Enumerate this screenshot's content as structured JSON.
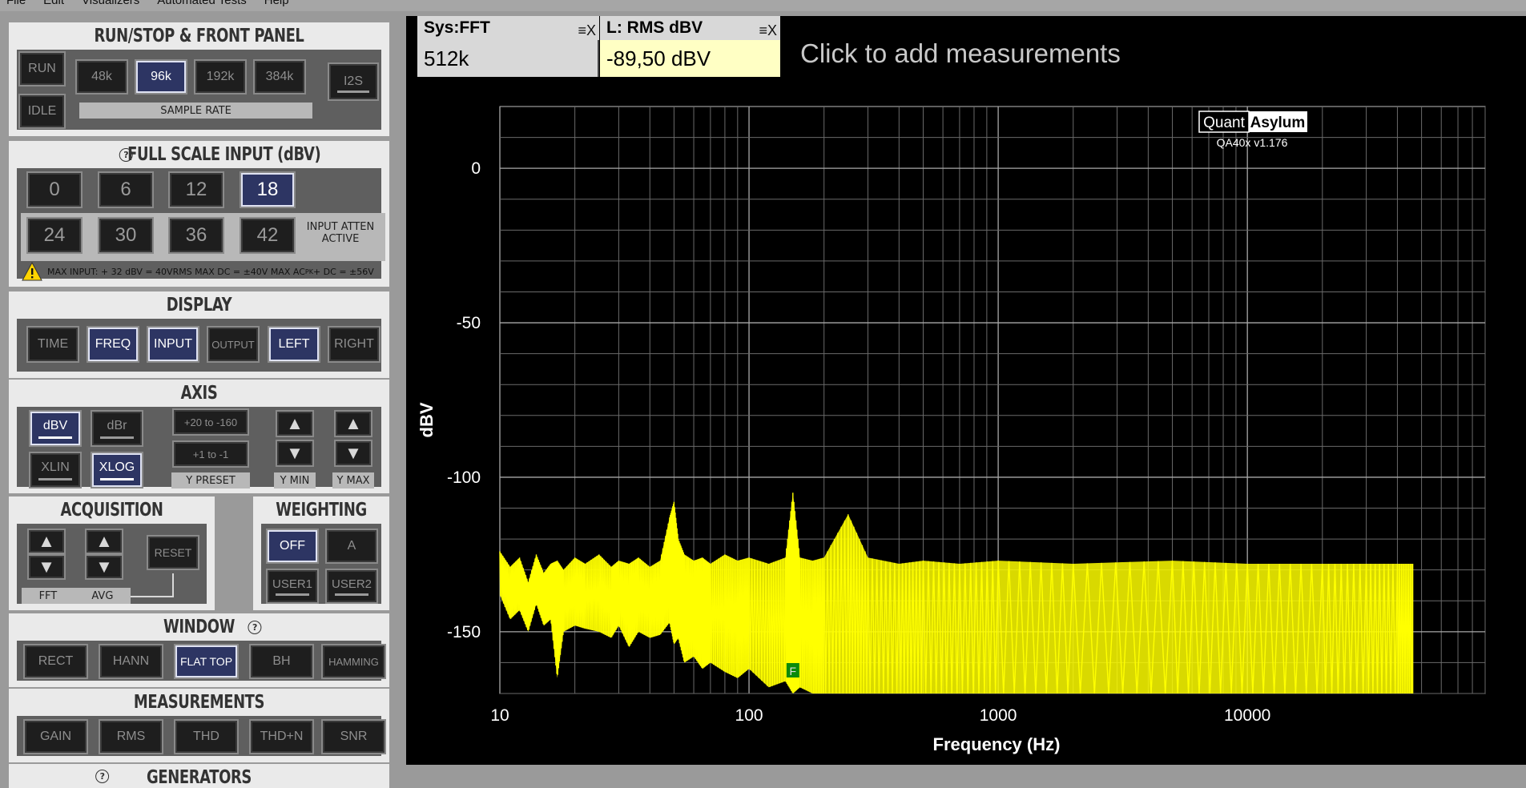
{
  "menu": [
    "File",
    "Edit",
    "Visualizers",
    "Automated Tests",
    "Help"
  ],
  "panels": {
    "run": {
      "title": "RUN/STOP & FRONT PANEL",
      "run": "RUN",
      "idle": "IDLE",
      "rates": [
        "48k",
        "96k",
        "192k",
        "384k"
      ],
      "rate_selected": "96k",
      "rate_label": "SAMPLE RATE",
      "i2s": "I2S"
    },
    "fsi": {
      "title": "FULL SCALE INPUT (dBV)",
      "values": [
        "0",
        "6",
        "12",
        "18",
        "24",
        "30",
        "36",
        "42"
      ],
      "selected": "18",
      "atten_label_1": "INPUT ATTEN",
      "atten_label_2": "ACTIVE",
      "warning": "MAX INPUT: + 32 dBV = 40VRMS    MAX DC = ±40V    MAX AC",
      "warning_sub": "PK",
      "warning_tail": " + DC = ±56V"
    },
    "display": {
      "title": "DISPLAY",
      "buttons": [
        "TIME",
        "FREQ",
        "INPUT",
        "OUTPUT",
        "LEFT",
        "RIGHT"
      ]
    },
    "axis": {
      "title": "AXIS",
      "dbv": "dBV",
      "dbr": "dBr",
      "xlin": "XLIN",
      "xlog": "XLOG",
      "preset1": "+20 to -160",
      "preset2": "+1 to -1",
      "ypreset": "Y PRESET",
      "ymin": "Y MIN",
      "ymax": "Y MAX"
    },
    "acq": {
      "title": "ACQUISITION",
      "reset": "RESET",
      "fft": "FFT",
      "avg": "AVG"
    },
    "weighting": {
      "title": "WEIGHTING",
      "off": "OFF",
      "a": "A",
      "user1": "USER1",
      "user2": "USER2"
    },
    "window": {
      "title": "WINDOW",
      "buttons": [
        "RECT",
        "HANN",
        "FLAT TOP",
        "BH",
        "HAMMING"
      ],
      "selected": "FLAT TOP"
    },
    "measurements": {
      "title": "MEASUREMENTS",
      "buttons": [
        "GAIN",
        "RMS",
        "THD",
        "THD+N",
        "SNR"
      ]
    },
    "generators": {
      "title": "GENERATORS"
    }
  },
  "meas_boxes": [
    {
      "title": "Sys:FFT",
      "value": "512k",
      "bg": "#d8d8d8"
    },
    {
      "title": "L: RMS dBV",
      "value": "-89,50 dBV",
      "bg": "#ffffc4"
    }
  ],
  "meas_ctrl": "≡X",
  "click_add": "Click to add measurements",
  "logo": {
    "left": "Quant",
    "right": "Asylum",
    "version": "QA40x v1.176"
  },
  "marker": "F",
  "colors": {
    "trace": "#ffff00",
    "plot_bg": "#000000",
    "button_on": "#2d3563"
  },
  "chart_data": {
    "type": "line",
    "xlabel": "Frequency (Hz)",
    "ylabel": "dBV",
    "xscale": "log",
    "xlim": [
      10,
      90000
    ],
    "ylim": [
      -170,
      20
    ],
    "xticks": [
      10,
      100,
      1000,
      10000
    ],
    "xtick_labels": [
      "10",
      "100",
      "1000",
      "10000"
    ],
    "yticks": [
      0,
      -50,
      -100,
      -150
    ],
    "ytick_labels": [
      "0",
      "-50",
      "-100",
      "-150"
    ],
    "grid": true,
    "series": [
      {
        "x": [
          10,
          11,
          12,
          13,
          14,
          15,
          16,
          17,
          18,
          20,
          22,
          25,
          28,
          30,
          33,
          36,
          40,
          44,
          48,
          50,
          52,
          55,
          60,
          65,
          70,
          80,
          90,
          100,
          120,
          140,
          150,
          160,
          180,
          200,
          250,
          300,
          400,
          500,
          700,
          1000,
          2000,
          5000,
          10000,
          20000,
          30000,
          40000,
          46000
        ],
        "y_top": [
          -124,
          -129,
          -126,
          -134,
          -125,
          -131,
          -128,
          -127,
          -130,
          -126,
          -128,
          -125,
          -129,
          -127,
          -128,
          -126,
          -129,
          -127,
          -113,
          -108,
          -120,
          -125,
          -127,
          -126,
          -128,
          -125,
          -127,
          -126,
          -128,
          -126,
          -105,
          -126,
          -127,
          -126,
          -112,
          -126,
          -128,
          -127,
          -128,
          -127,
          -128,
          -127,
          -128,
          -128,
          -128,
          -128,
          -128
        ],
        "y_bottom": [
          -138,
          -146,
          -143,
          -150,
          -141,
          -148,
          -146,
          -165,
          -150,
          -148,
          -149,
          -150,
          -152,
          -148,
          -155,
          -150,
          -152,
          -151,
          -147,
          -154,
          -152,
          -160,
          -158,
          -162,
          -160,
          -163,
          -165,
          -162,
          -168,
          -166,
          -170,
          -168,
          -170,
          -170,
          -170,
          -170,
          -170,
          -170,
          -170,
          -170,
          -170,
          -170,
          -170,
          -170,
          -170,
          -170,
          -170
        ]
      }
    ]
  }
}
